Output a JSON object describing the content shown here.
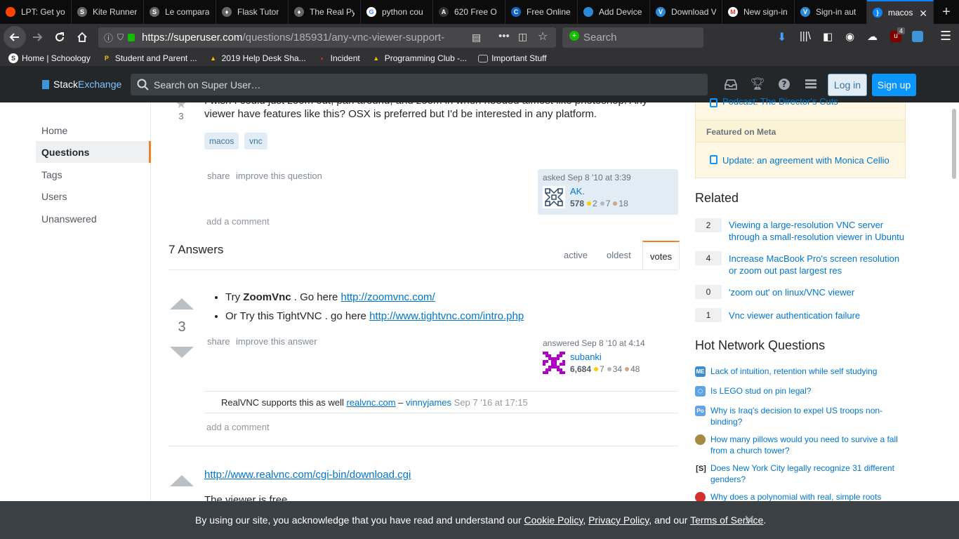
{
  "tabs": [
    {
      "title": "LPT: Get yo",
      "color": "#ff4500",
      "glyph": "r"
    },
    {
      "title": "Kite Runner",
      "color": "#666",
      "glyph": "S"
    },
    {
      "title": "Le compara",
      "color": "#666",
      "glyph": "S"
    },
    {
      "title": "Flask Tutor",
      "color": "#666",
      "glyph": "♦"
    },
    {
      "title": "The Real Py",
      "color": "#666",
      "glyph": "♦"
    },
    {
      "title": "python cou",
      "color": "#fff",
      "glyph": "G"
    },
    {
      "title": "620 Free O",
      "color": "#333",
      "glyph": "A"
    },
    {
      "title": "Free Online",
      "color": "#1565c0",
      "glyph": "C"
    },
    {
      "title": "Add Device",
      "color": "#2c89d6",
      "glyph": "r"
    },
    {
      "title": "Download V",
      "color": "#2c89d6",
      "glyph": "V"
    },
    {
      "title": "New sign-in",
      "color": "#d23f31",
      "glyph": "M"
    },
    {
      "title": "Sign-in aut",
      "color": "#2c89d6",
      "glyph": "V"
    },
    {
      "title": "macos",
      "color": "#0a84ff",
      "glyph": "}"
    }
  ],
  "browser": {
    "url_host": "https://superuser.com",
    "url_rest": "/questions/185931/any-vnc-viewer-support-",
    "search_placeholder": "Search",
    "badge": "4"
  },
  "bookmarks": [
    {
      "label": "Home | Schoology",
      "color": "#fff",
      "glyph": "S"
    },
    {
      "label": "Student and Parent ...",
      "color": "#f5c518",
      "glyph": "P"
    },
    {
      "label": "2019 Help Desk Sha...",
      "color": "#fbbc04",
      "glyph": "▲"
    },
    {
      "label": "Incident",
      "color": "#e53935",
      "glyph": "◗"
    },
    {
      "label": "Programming Club -...",
      "color": "#fbbc04",
      "glyph": "▲"
    },
    {
      "label": "Important Stuff",
      "color": "#9b9b9b",
      "glyph": "▭"
    }
  ],
  "site": {
    "logo_a": "Stack",
    "logo_b": "Exchange",
    "search_placeholder": "Search on Super User…",
    "login": "Log in",
    "signup": "Sign up"
  },
  "leftnav": [
    "Home",
    "Questions",
    "Tags",
    "Users",
    "Unanswered"
  ],
  "question": {
    "text_partial": "I wish I could just zoom out, pan around, and zoom in when needed almost like photoshop. Any viewer have features like this? OSX is preferred but I'd be interested in any platform.",
    "votes": "3",
    "tags": [
      "macos",
      "vnc"
    ],
    "share": "share",
    "improve": "improve this question",
    "asked": "asked Sep 8 '10 at 3:39",
    "user": "AK.",
    "rep": "578",
    "gold": "2",
    "silver": "7",
    "bronze": "18",
    "add_comment": "add a comment"
  },
  "answers_header": "7 Answers",
  "sort_tabs": [
    "active",
    "oldest",
    "votes"
  ],
  "answer1": {
    "votes": "3",
    "bullet1_pre": "Try ",
    "bullet1_bold": "ZoomVnc",
    "bullet1_mid": " . Go here ",
    "bullet1_link": "http://zoomvnc.com/",
    "bullet2_pre": "Or Try this TightVNC . go here ",
    "bullet2_link": "http://www.tightvnc.com/intro.php",
    "share": "share",
    "improve": "improve this answer",
    "answered": "answered Sep 8 '10 at 4:14",
    "user": "subanki",
    "rep": "6,684",
    "gold": "7",
    "silver": "34",
    "bronze": "48",
    "comment_text": "RealVNC supports this as well ",
    "comment_link": "realvnc.com",
    "comment_sep": " – ",
    "comment_user": "vinnyjames",
    "comment_date": " Sep 7 '16 at 17:15",
    "add_comment": "add a comment"
  },
  "answer2": {
    "link": "http://www.realvnc.com/cgi-bin/download.cgi",
    "text": "The viewer is free"
  },
  "sidebar": {
    "blog_item": "Podcast: The Director's Cuts",
    "meta_header": "Featured on Meta",
    "meta_item": "Update: an agreement with Monica Cellio",
    "related_header": "Related",
    "related": [
      {
        "count": "2",
        "title": "Viewing a large-resolution VNC server through a small-resolution viewer in Ubuntu"
      },
      {
        "count": "4",
        "title": "Increase MacBook Pro's screen resolution or zoom out past largest res"
      },
      {
        "count": "0",
        "title": "'zoom out' on linux/VNC viewer"
      },
      {
        "count": "1",
        "title": "Vnc viewer authentication failure"
      }
    ],
    "hot_header": "Hot Network Questions",
    "hot": [
      {
        "icon": "ME",
        "color": "#3b8fd0",
        "title": "Lack of intuition, retention while self studying"
      },
      {
        "icon": "⬡",
        "color": "#5ba4e5",
        "title": "Is LEGO stud on pin legal?"
      },
      {
        "icon": "Po",
        "color": "#63a4e8",
        "title": "Why is Iraq's decision to expel US troops non-binding?"
      },
      {
        "icon": "●",
        "color": "#a58a3f",
        "title": "How many pillows would you need to survive a fall from a church tower?"
      },
      {
        "icon": "[S]",
        "color": "#222",
        "title": "Does New York City legally recognize 31 different genders?"
      },
      {
        "icon": "✿",
        "color": "#d32f2f",
        "title": "Why does a polynomial with real, simple roots"
      }
    ]
  },
  "cookie": {
    "pre": "By using our site, you acknowledge that you have read and understand our ",
    "cookie_policy": "Cookie Policy",
    "comma": ", ",
    "privacy_policy": "Privacy Policy",
    "and": ", and our ",
    "terms": "Terms of Service",
    "end": "."
  }
}
